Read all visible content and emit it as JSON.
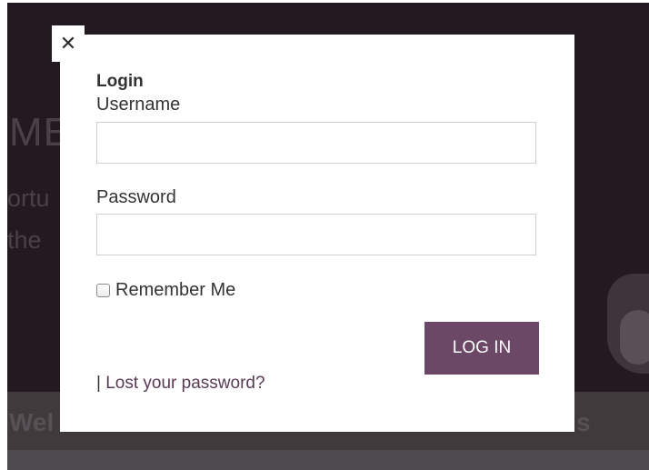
{
  "background": {
    "hero_title": "ME",
    "hero_line_1": "ortu",
    "hero_line_2": "the",
    "band_text_left": "Wel",
    "band_text_right": "s"
  },
  "modal": {
    "close_symbol": "✕",
    "title": "Login",
    "username_label": "Username",
    "username_value": "",
    "password_label": "Password",
    "password_value": "",
    "remember_label": "Remember Me",
    "remember_checked": false,
    "login_button": "LOG IN",
    "lost_separator": "|",
    "lost_password_link": "Lost your password?"
  },
  "colors": {
    "overlay": "#221a20",
    "button": "#6b4865"
  },
  "icons": {
    "close": "close-icon",
    "checkbox": "checkbox-icon"
  }
}
